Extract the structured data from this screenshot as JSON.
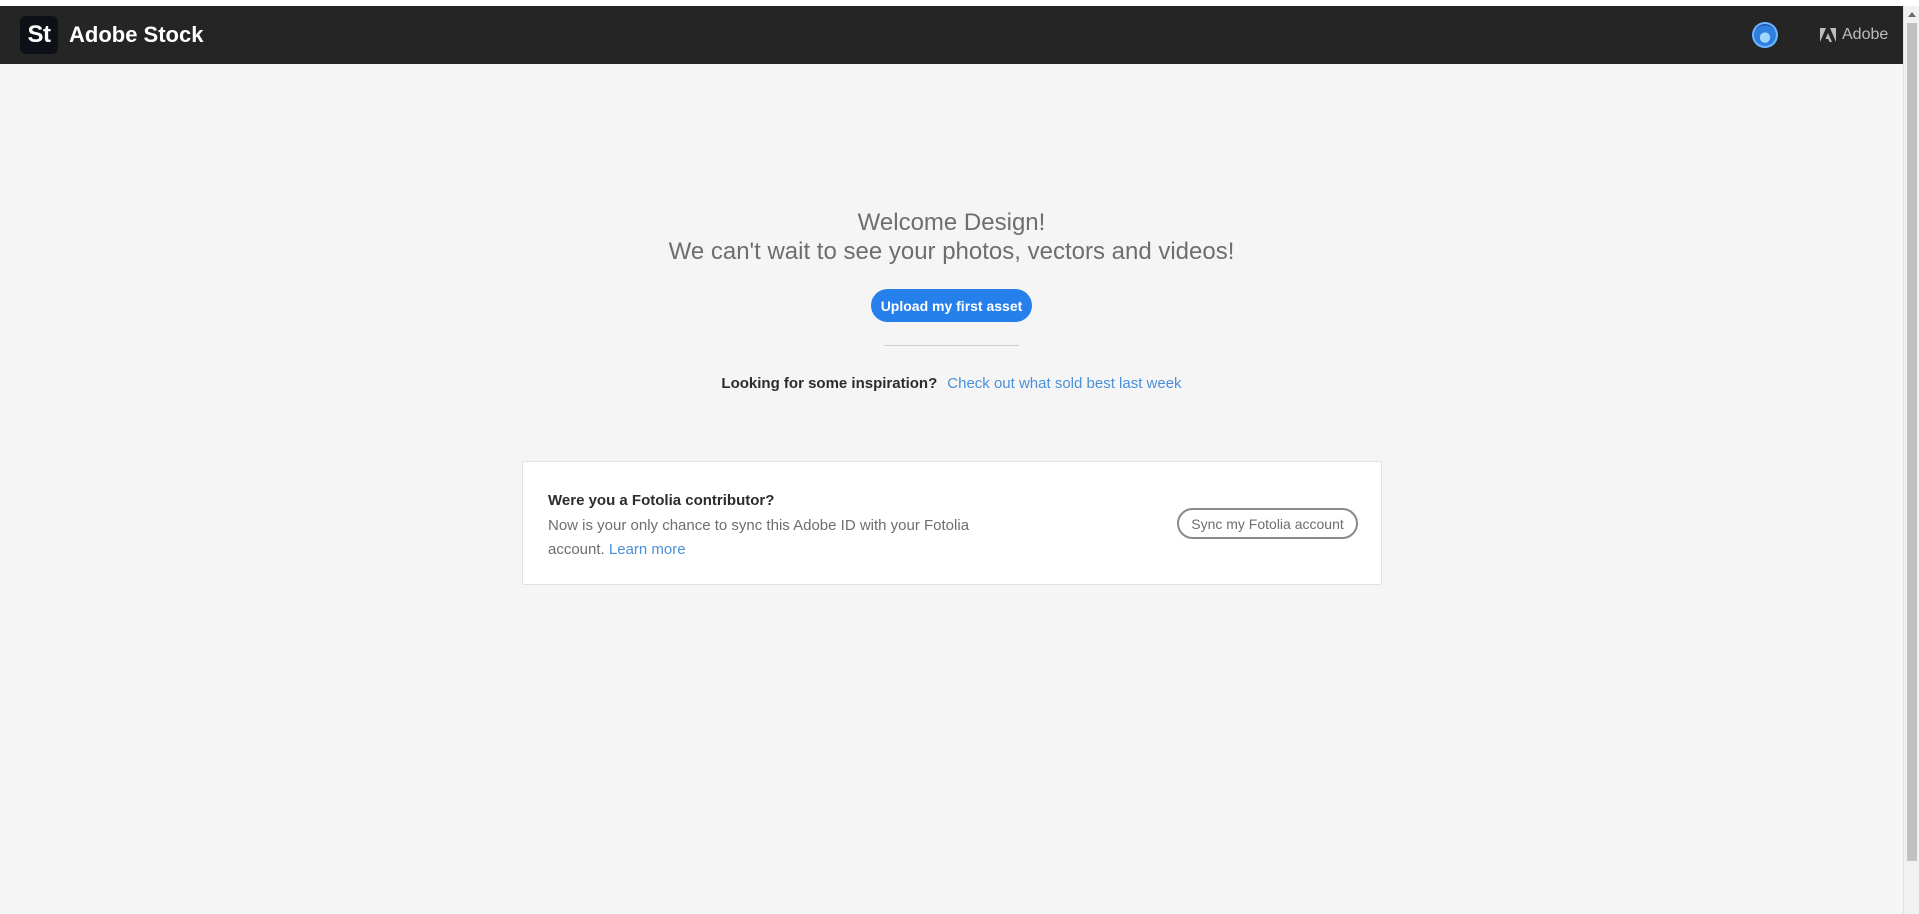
{
  "header": {
    "logo_text": "St",
    "brand": "Adobe Stock",
    "adobe_link": "Adobe",
    "background_color": "#252525"
  },
  "welcome": {
    "line1": "Welcome Design!",
    "line2": "We can't wait to see your photos, vectors and videos!"
  },
  "upload_button": {
    "label": "Upload my first asset",
    "color": "#2680eb"
  },
  "inspiration": {
    "question": "Looking for some inspiration?",
    "link": "Check out what sold best last week"
  },
  "fotolia_card": {
    "title": "Were you a Fotolia contributor?",
    "body": "Now is your only chance to sync this Adobe ID with your Fotolia account.",
    "learn_more": "Learn more",
    "sync_button": "Sync my Fotolia account"
  },
  "icons": {
    "avatar": "user-avatar-icon",
    "adobe_logo": "adobe-logo-icon",
    "scroll_up": "chevron-up-icon"
  }
}
